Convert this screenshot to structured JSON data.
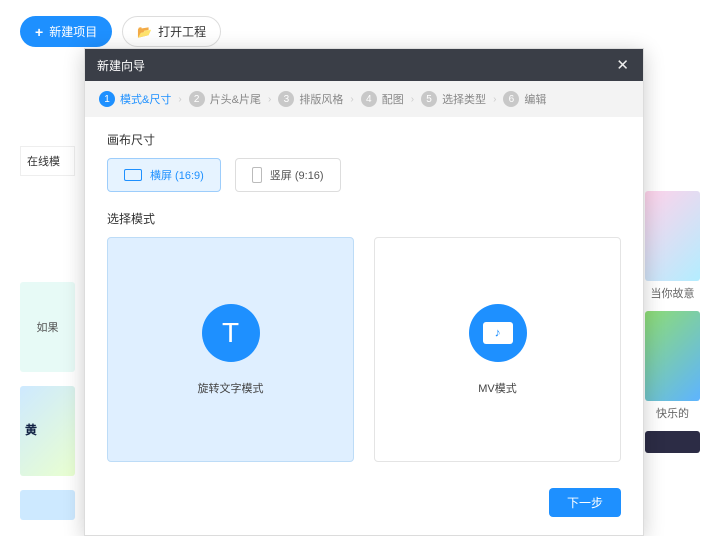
{
  "topbar": {
    "new_project": "新建项目",
    "open_project": "打开工程"
  },
  "bg": {
    "left_label": "在线模",
    "left_txt1": "如果",
    "left_txt2": "黄",
    "r1_cap": "当你故意",
    "r2_cap": "快乐的"
  },
  "modal": {
    "title": "新建向导",
    "steps": [
      {
        "n": "1",
        "label": "模式&尺寸"
      },
      {
        "n": "2",
        "label": "片头&片尾"
      },
      {
        "n": "3",
        "label": "排版风格"
      },
      {
        "n": "4",
        "label": "配图"
      },
      {
        "n": "5",
        "label": "选择类型"
      },
      {
        "n": "6",
        "label": "编辑"
      }
    ],
    "canvas_title": "画布尺寸",
    "size_h": "横屏 (16:9)",
    "size_v": "竖屏 (9:16)",
    "mode_title": "选择模式",
    "mode_text": "旋转文字模式",
    "mode_mv": "MV模式",
    "next": "下一步"
  }
}
